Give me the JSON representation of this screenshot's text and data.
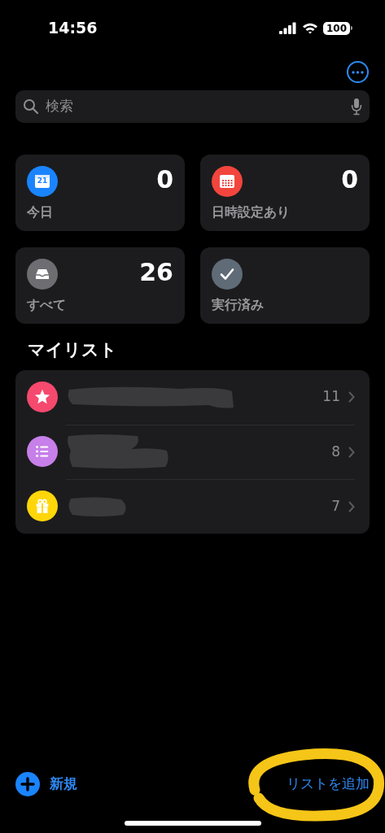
{
  "status_bar": {
    "time": "14:56",
    "battery": "100"
  },
  "search": {
    "placeholder": "検索"
  },
  "smart_lists": [
    {
      "kind": "today",
      "color": "#1a84ff",
      "icon_text": "21",
      "label": "今日",
      "count": "0"
    },
    {
      "kind": "scheduled",
      "color": "#f2453d",
      "label": "日時設定あり",
      "count": "0"
    },
    {
      "kind": "all",
      "color": "#6d6d72",
      "label": "すべて",
      "count": "26"
    },
    {
      "kind": "completed",
      "color": "#5f6b76",
      "label": "実行済み"
    }
  ],
  "my_lists": {
    "title": "マイリスト",
    "items": [
      {
        "kind": "star",
        "color": "#f6496e",
        "count": "11"
      },
      {
        "kind": "list",
        "color": "#c77fe9",
        "count": "8"
      },
      {
        "kind": "gift",
        "color": "#ffd60a",
        "count": "7"
      }
    ]
  },
  "toolbar": {
    "new_reminder": "新規",
    "add_list": "リストを追加"
  }
}
